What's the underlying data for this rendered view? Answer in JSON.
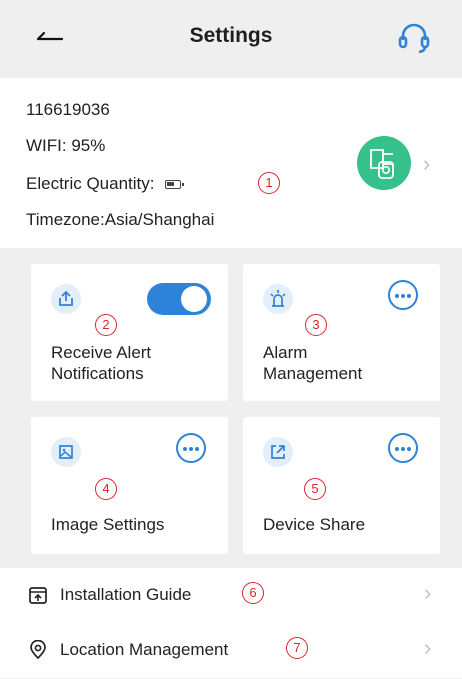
{
  "header": {
    "title": "Settings",
    "back_icon": "back-arrow-icon",
    "support_icon": "headset-icon"
  },
  "device": {
    "id": "116619036",
    "wifi": "WIFI:  95%",
    "electric_quantity": "Electric Quantity:",
    "battery_icon": "battery-low-icon",
    "timezone": "Timezone:Asia/Shanghai",
    "avatar_icon": "camera-icon",
    "avatar_color": "#35c08c"
  },
  "markers": [
    "1",
    "2",
    "3",
    "4",
    "5",
    "6",
    "7"
  ],
  "cards": [
    {
      "label_line1": "Receive Alert",
      "label_line2": "Notifications",
      "icon": "upload-tray-icon",
      "control": "toggle",
      "toggle_on": true
    },
    {
      "label_line1": "Alarm",
      "label_line2": "Management",
      "icon": "alarm-light-icon",
      "control": "more"
    },
    {
      "label_line1": "Image Settings",
      "icon": "image-icon",
      "control": "more"
    },
    {
      "label_line1": "Device Share",
      "icon": "share-icon",
      "control": "more"
    }
  ],
  "menu": [
    {
      "label": "Installation Guide",
      "icon": "installation-guide-icon"
    },
    {
      "label": "Location Management",
      "icon": "location-pin-icon"
    }
  ],
  "colors": {
    "accent": "#2e83d8",
    "marker": "#d8262b",
    "background": "#efefef"
  }
}
